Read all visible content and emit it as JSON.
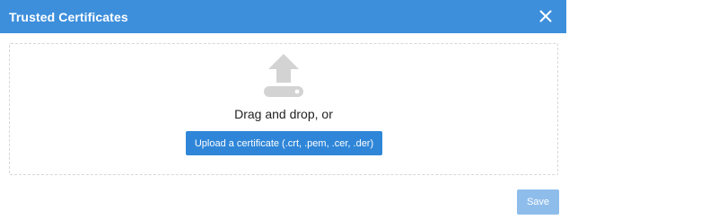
{
  "dialog": {
    "title": "Trusted Certificates",
    "close_icon": "close-icon"
  },
  "dropzone": {
    "icon": "upload-icon",
    "prompt": "Drag and drop, or",
    "upload_button_label": "Upload a certificate (.crt, .pem, .cer, .der)"
  },
  "footer": {
    "save_label": "Save",
    "save_enabled": false
  },
  "colors": {
    "titlebar": "#3d8fdc",
    "primary_button": "#2f86d8",
    "disabled_button": "#8ebdeb",
    "icon_gray": "#d3d3d3",
    "dashed_border": "#d7d7d7"
  }
}
